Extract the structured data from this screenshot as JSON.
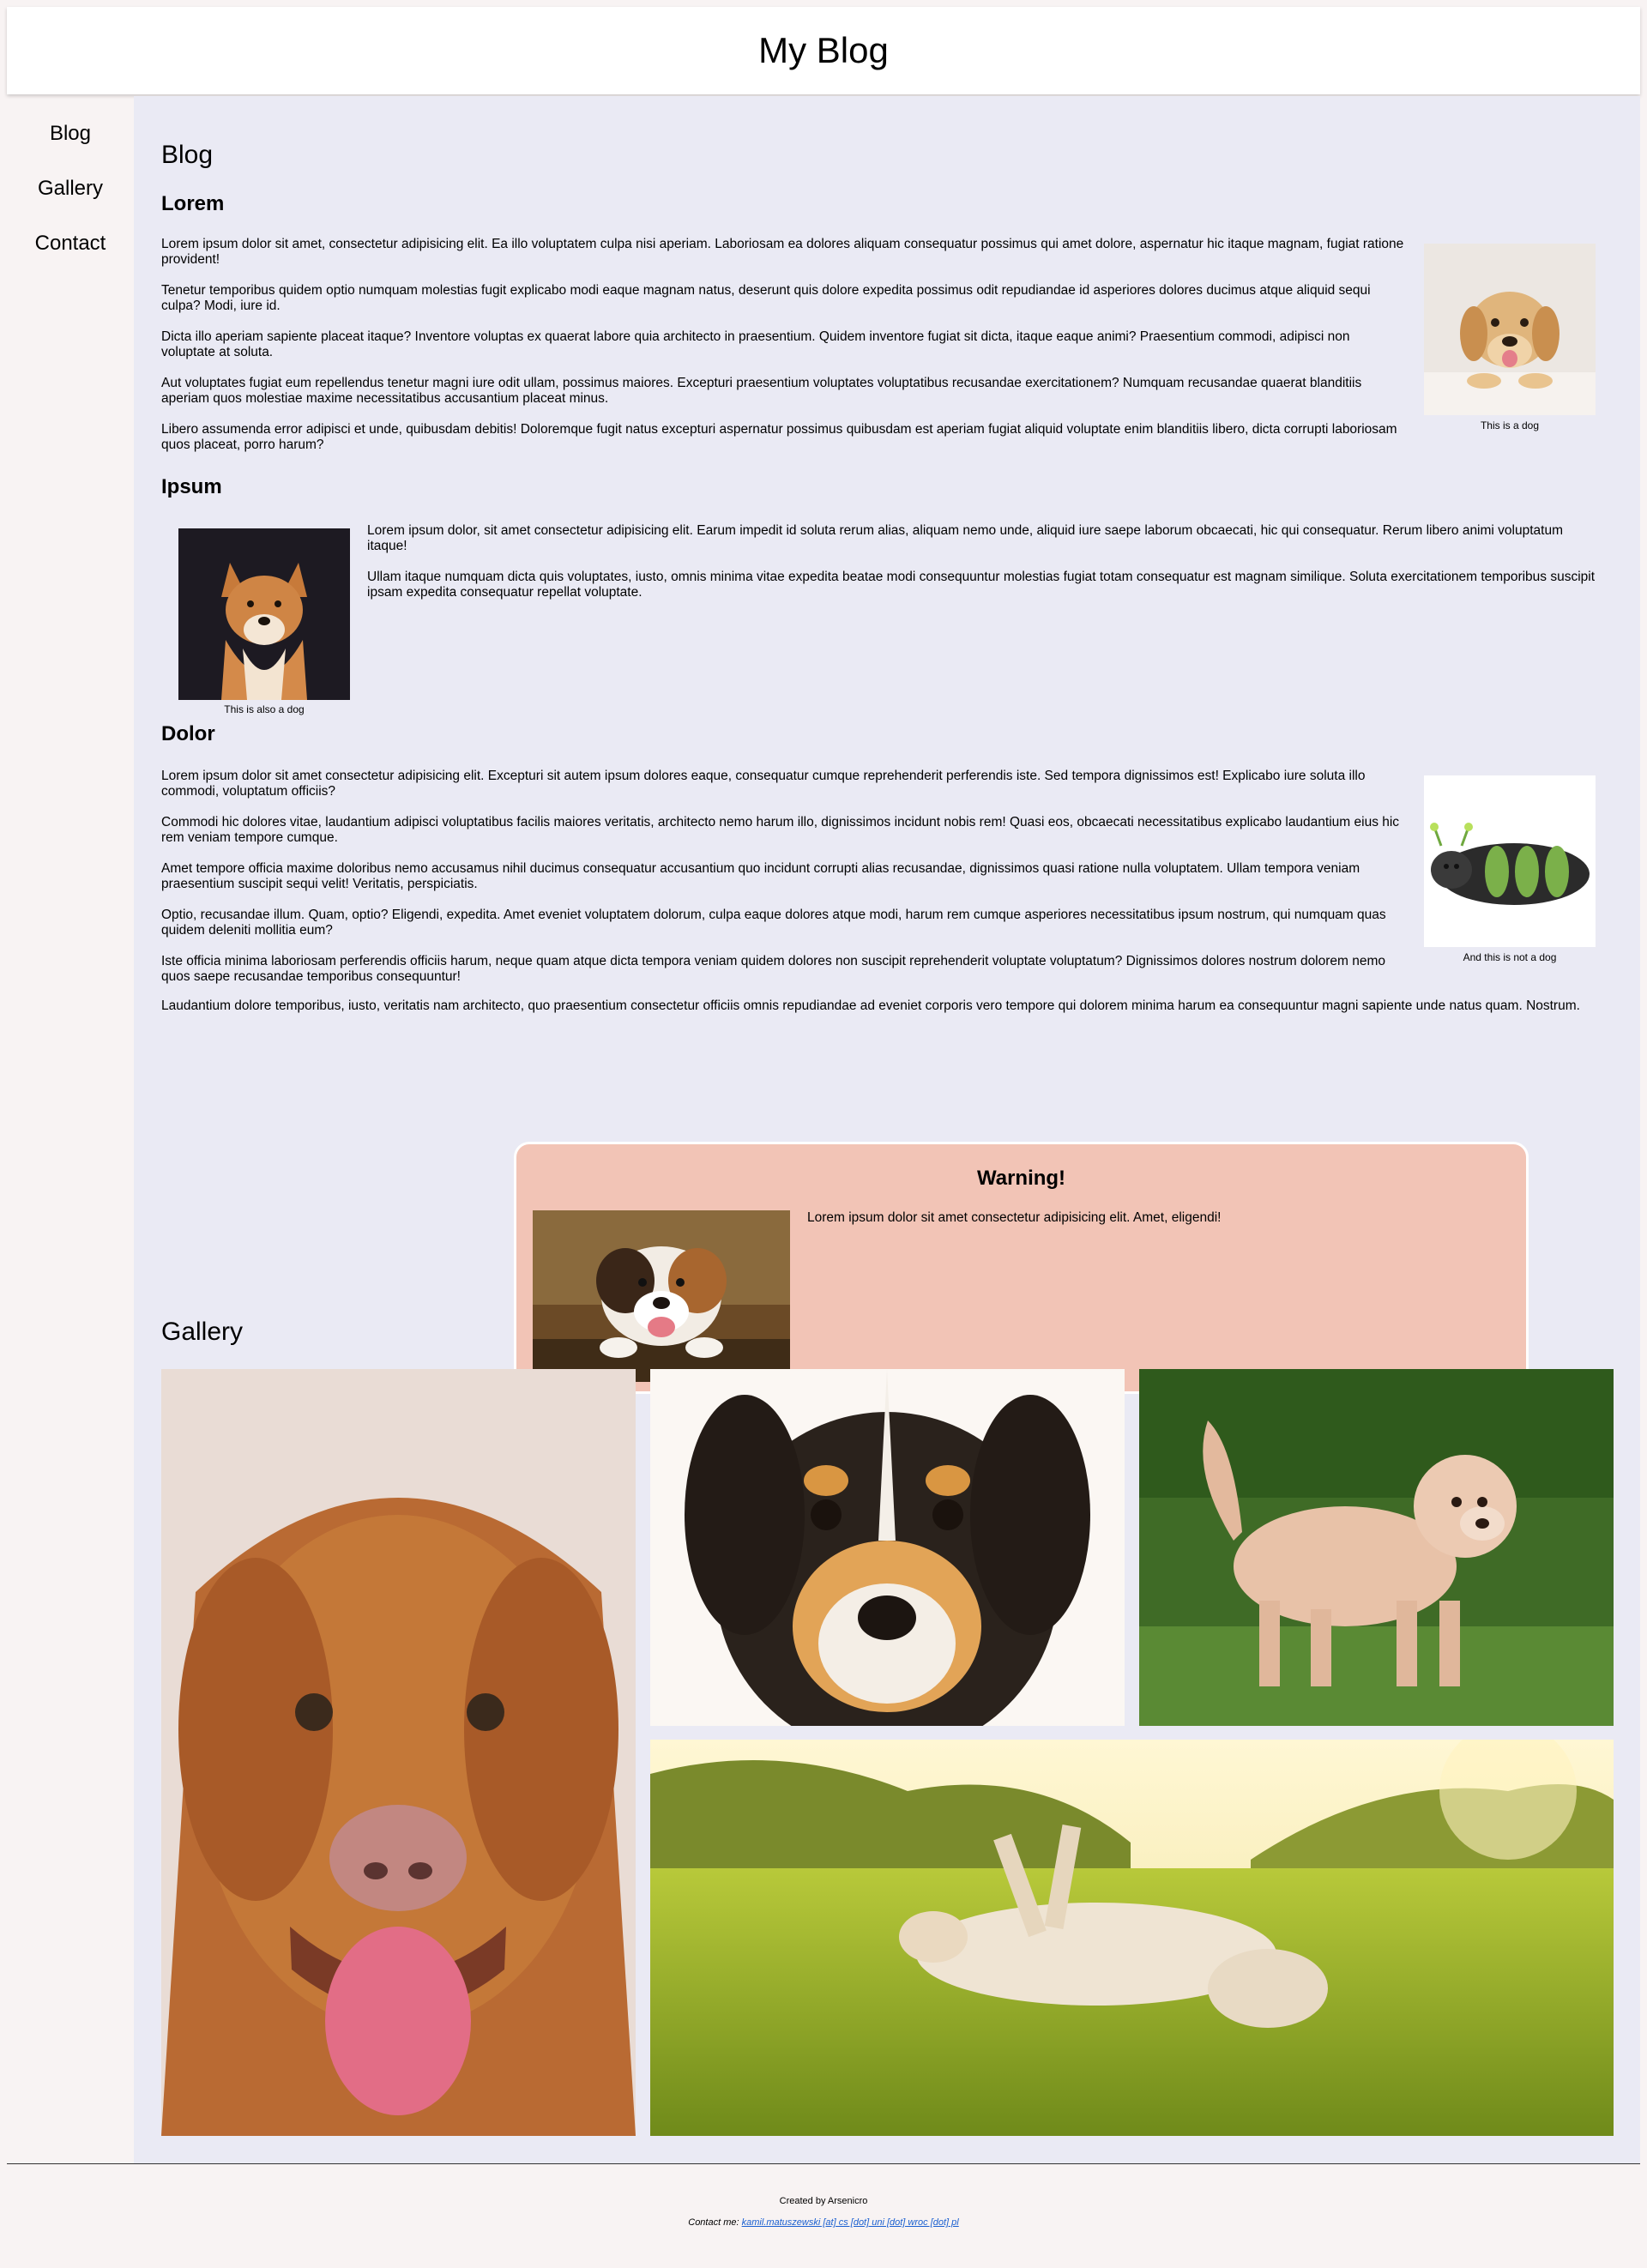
{
  "header": {
    "title": "My Blog"
  },
  "nav": {
    "items": [
      {
        "label": "Blog"
      },
      {
        "label": "Gallery"
      },
      {
        "label": "Contact"
      }
    ]
  },
  "blog": {
    "heading": "Blog",
    "lorem": {
      "title": "Lorem",
      "paragraphs": [
        "Lorem ipsum dolor sit amet, consectetur adipisicing elit. Ea illo voluptatem culpa nisi aperiam. Laboriosam ea dolores aliquam consequatur possimus qui amet dolore, aspernatur hic itaque magnam, fugiat ratione provident!",
        "Tenetur temporibus quidem optio numquam molestias fugit explicabo modi eaque magnam natus, deserunt quis dolore expedita possimus odit repudiandae id asperiores dolores ducimus atque aliquid sequi culpa? Modi, iure id.",
        "Dicta illo aperiam sapiente placeat itaque? Inventore voluptas ex quaerat labore quia architecto in praesentium. Quidem inventore fugiat sit dicta, itaque eaque animi? Praesentium commodi, adipisci non voluptate at soluta.",
        "Aut voluptates fugiat eum repellendus tenetur magni iure odit ullam, possimus maiores. Excepturi praesentium voluptates voluptatibus recusandae exercitationem? Numquam recusandae quaerat blanditiis aperiam quos molestiae maxime necessitatibus accusantium placeat minus.",
        "Libero assumenda error adipisci et unde, quibusdam debitis! Doloremque fugit natus excepturi aspernatur possimus quibusdam est aperiam fugiat aliquid voluptate enim blanditiis libero, dicta corrupti laboriosam quos placeat, porro harum?"
      ],
      "caption": "This is a dog"
    },
    "ipsum": {
      "title": "Ipsum",
      "paragraphs": [
        "Lorem ipsum dolor, sit amet consectetur adipisicing elit. Earum impedit id soluta rerum alias, aliquam nemo unde, aliquid iure saepe laborum obcaecati, hic qui consequatur. Rerum libero animi voluptatum itaque!",
        "Ullam itaque numquam dicta quis voluptates, iusto, omnis minima vitae expedita beatae modi consequuntur molestias fugiat totam consequatur est magnam similique. Soluta exercitationem temporibus suscipit ipsam expedita consequatur repellat voluptate."
      ],
      "caption": "This is also a dog"
    },
    "dolor": {
      "title": "Dolor",
      "paragraphs": [
        "Lorem ipsum dolor sit amet consectetur adipisicing elit. Excepturi sit autem ipsum dolores eaque, consequatur cumque reprehenderit perferendis iste. Sed tempora dignissimos est! Explicabo iure soluta illo commodi, voluptatum officiis?",
        "Commodi hic dolores vitae, laudantium adipisci voluptatibus facilis maiores veritatis, architecto nemo harum illo, dignissimos incidunt nobis rem! Quasi eos, obcaecati necessitatibus explicabo laudantium eius hic rem veniam tempore cumque.",
        "Amet tempore officia maxime doloribus nemo accusamus nihil ducimus consequatur accusantium quo incidunt corrupti alias recusandae, dignissimos quasi ratione nulla voluptatem. Ullam tempora veniam praesentium suscipit sequi velit! Veritatis, perspiciatis.",
        "Optio, recusandae illum. Quam, optio? Eligendi, expedita. Amet eveniet voluptatem dolorum, culpa eaque dolores atque modi, harum rem cumque asperiores necessitatibus ipsum nostrum, qui numquam quas quidem deleniti mollitia eum?",
        "Iste officia minima laboriosam perferendis officiis harum, neque quam atque dicta tempora veniam quidem dolores non suscipit reprehenderit voluptate voluptatum? Dignissimos dolores nostrum dolorem nemo quos saepe recusandae temporibus consequuntur!",
        "Laudantium dolore temporibus, iusto, veritatis nam architecto, quo praesentium consectetur officiis omnis repudiandae ad eveniet corporis vero tempore qui dolorem minima harum ea consequuntur magni sapiente unde natus quam. Nostrum."
      ],
      "caption": "And this is not a dog"
    },
    "warning": {
      "title": "Warning!",
      "text": "Lorem ipsum dolor sit amet consectetur adipisicing elit. Amet, eligendi!"
    }
  },
  "gallery": {
    "heading": "Gallery"
  },
  "footer": {
    "created": "Created by Arsenicro",
    "contact_label": "Contact me:",
    "contact_email": "kamil.matuszewski [at] cs [dot] uni [dot] wroc [dot] pl"
  }
}
